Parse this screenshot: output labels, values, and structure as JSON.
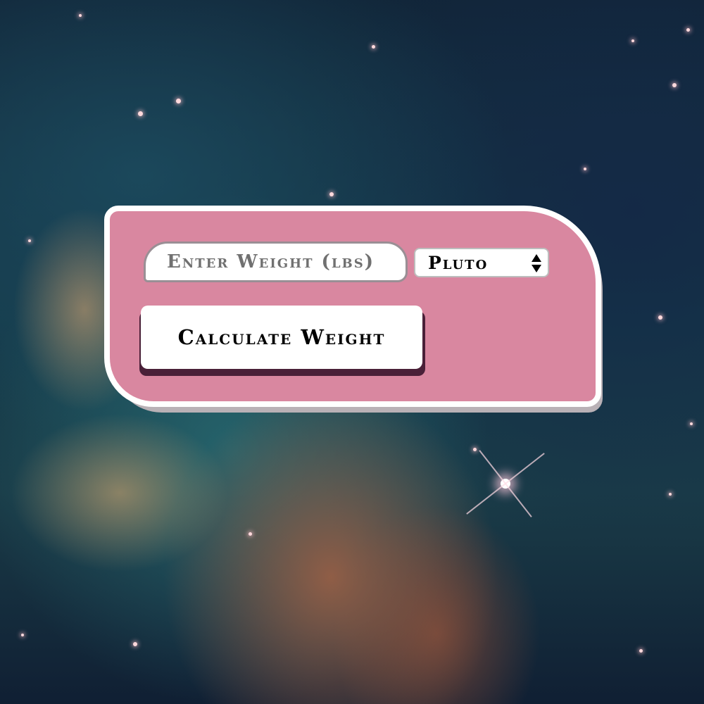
{
  "calculator": {
    "weight_input": {
      "placeholder": "Enter Weight (lbs)",
      "value": ""
    },
    "planet_select": {
      "selected": "Pluto"
    },
    "calculate_button": {
      "label": "Calculate Weight"
    }
  },
  "colors": {
    "card_background": "#d987a0",
    "card_border": "#ffffff",
    "button_shadow": "#4a2038",
    "text": "#000000"
  }
}
